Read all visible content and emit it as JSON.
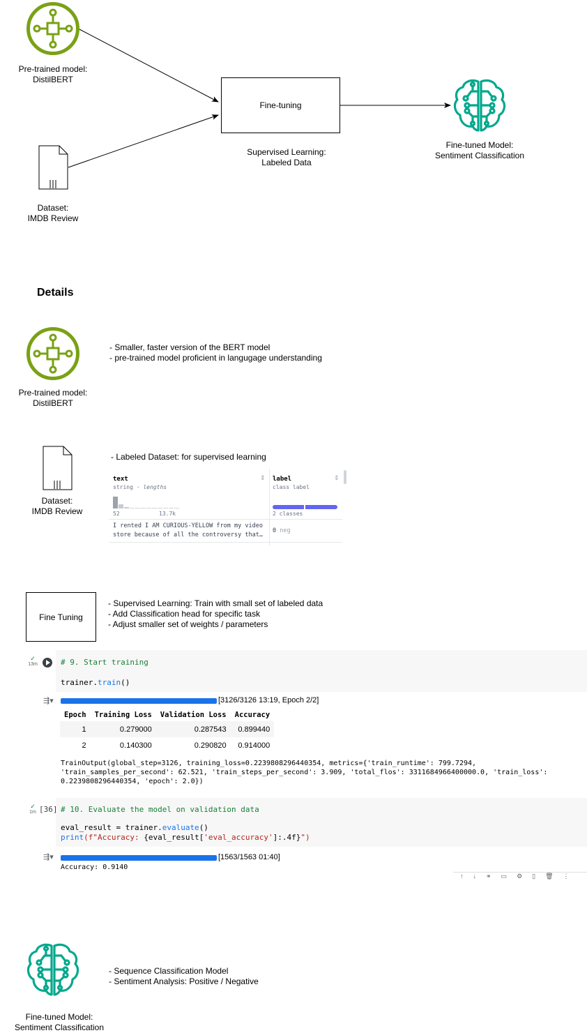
{
  "top": {
    "pretrained_caption": [
      "Pre-trained model:",
      "DistilBERT"
    ],
    "finetuning_box": "Fine-tuning",
    "supervised_caption": [
      "Supervised Learning:",
      "Labeled Data"
    ],
    "finetuned_caption": [
      "Fine-tuned Model:",
      "Sentiment Classification"
    ],
    "dataset_caption": [
      "Dataset:",
      "IMDB Review"
    ]
  },
  "details_heading": "Details",
  "pretrained_section": {
    "caption": [
      "Pre-trained model:",
      "DistilBERT"
    ],
    "bullets": [
      "- Smaller, faster version of the BERT model",
      "- pre-trained model proficient in langugage understanding"
    ]
  },
  "dataset_section": {
    "caption": [
      "Dataset:",
      "IMDB Review"
    ],
    "bullet": "- Labeled Dataset: for supervised learning",
    "preview": {
      "col1_name": "text",
      "col1_type": "string",
      "col1_type_extra": "· lengths",
      "col1_min": "52",
      "col1_max": "13.7k",
      "col2_name": "label",
      "col2_type": "class label",
      "col2_classes": "2 classes",
      "row_text": [
        "I rented I AM CURIOUS-YELLOW from my video",
        "store because of all the controversy that…"
      ],
      "row_label_value": "0",
      "row_label_name": "neg"
    }
  },
  "finetune_section": {
    "box": "Fine Tuning",
    "bullets": [
      "- Supervised Learning: Train with small set of labeled data",
      "- Add Classification head for specific task",
      "- Adjust smaller set of weights / parameters"
    ]
  },
  "notebook": {
    "cell1": {
      "time": "13m",
      "comment": "# 9. Start training",
      "code_obj": "trainer",
      "code_fn": "train",
      "progress": "[3126/3126 13:19, Epoch 2/2]",
      "progress_fraction": 1.0,
      "table": {
        "headers": [
          "Epoch",
          "Training Loss",
          "Validation Loss",
          "Accuracy"
        ],
        "rows": [
          [
            "1",
            "0.279000",
            "0.287543",
            "0.899440"
          ],
          [
            "2",
            "0.140300",
            "0.290820",
            "0.914000"
          ]
        ]
      },
      "output": [
        "TrainOutput(global_step=3126, training_loss=0.2239808296440354, metrics={'train_runtime': 799.7294,",
        "'train_samples_per_second': 62.521, 'train_steps_per_second': 3.909, 'total_flos': 3311684966400000.0, 'train_loss':",
        "0.2239808296440354, 'epoch': 2.0})"
      ]
    },
    "cell2": {
      "time": "1m",
      "exec_count": "[36]",
      "comment": "# 10. Evaluate the model on validation data",
      "line1_var": "eval_result = trainer.",
      "line1_fn": "evaluate",
      "line1_end": "()",
      "line2_fn": "print",
      "line2_str_a": "(f\"Accuracy: ",
      "line2_expr": "{eval_result[",
      "line2_key": "'eval_accuracy'",
      "line2_expr2": "]:.4f}",
      "line2_str_b": "\")",
      "progress": "[1563/1563 01:40]",
      "progress_fraction": 1.0,
      "output": "Accuracy: 0.9140"
    }
  },
  "finetuned_section": {
    "caption": [
      "Fine-tuned Model:",
      "Sentiment Classification"
    ],
    "bullets": [
      "- Sequence Classification Model",
      "- Sentiment Analysis: Positive / Negative"
    ]
  },
  "colors": {
    "model_green": "#7aa116",
    "brain_teal": "#01a88d",
    "progress_blue": "#1a73e8",
    "class_bar": "#6366f1"
  }
}
